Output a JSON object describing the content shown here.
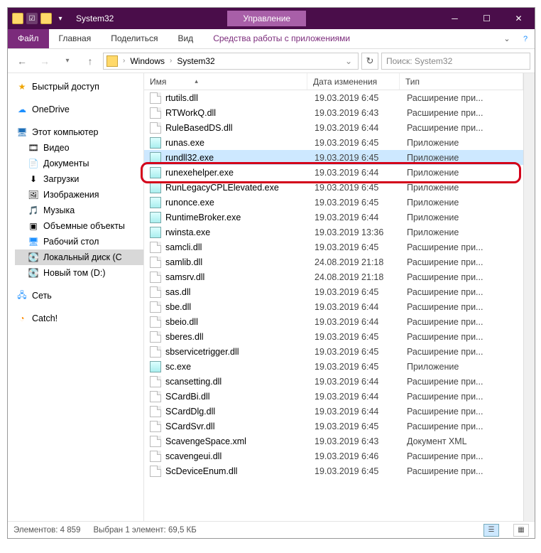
{
  "titlebar": {
    "title": "System32",
    "center_tab": "Управление"
  },
  "ribbon": {
    "file": "Файл",
    "tabs": [
      "Главная",
      "Поделиться",
      "Вид"
    ],
    "context_tab": "Средства работы с приложениями"
  },
  "address": {
    "segments": [
      "Windows",
      "System32"
    ],
    "search_placeholder": "Поиск: System32"
  },
  "nav": {
    "quick": "Быстрый доступ",
    "onedrive": "OneDrive",
    "thispc": "Этот компьютер",
    "pc_items": [
      "Видео",
      "Документы",
      "Загрузки",
      "Изображения",
      "Музыка",
      "Объемные объекты",
      "Рабочий стол"
    ],
    "drives": [
      "Локальный диск (C",
      "Новый том (D:)"
    ],
    "network": "Сеть",
    "catch": "Catch!"
  },
  "columns": {
    "name": "Имя",
    "date": "Дата изменения",
    "type": "Тип"
  },
  "files": [
    {
      "name": "rtutils.dll",
      "date": "19.03.2019 6:45",
      "type": "Расширение при...",
      "exe": false
    },
    {
      "name": "RTWorkQ.dll",
      "date": "19.03.2019 6:43",
      "type": "Расширение при...",
      "exe": false
    },
    {
      "name": "RuleBasedDS.dll",
      "date": "19.03.2019 6:44",
      "type": "Расширение при...",
      "exe": false
    },
    {
      "name": "runas.exe",
      "date": "19.03.2019 6:45",
      "type": "Приложение",
      "exe": true
    },
    {
      "name": "rundll32.exe",
      "date": "19.03.2019 6:45",
      "type": "Приложение",
      "exe": true,
      "selected": true
    },
    {
      "name": "runexehelper.exe",
      "date": "19.03.2019 6:44",
      "type": "Приложение",
      "exe": true
    },
    {
      "name": "RunLegacyCPLElevated.exe",
      "date": "19.03.2019 6:45",
      "type": "Приложение",
      "exe": true
    },
    {
      "name": "runonce.exe",
      "date": "19.03.2019 6:45",
      "type": "Приложение",
      "exe": true
    },
    {
      "name": "RuntimeBroker.exe",
      "date": "19.03.2019 6:44",
      "type": "Приложение",
      "exe": true
    },
    {
      "name": "rwinsta.exe",
      "date": "19.03.2019 13:36",
      "type": "Приложение",
      "exe": true
    },
    {
      "name": "samcli.dll",
      "date": "19.03.2019 6:45",
      "type": "Расширение при...",
      "exe": false
    },
    {
      "name": "samlib.dll",
      "date": "24.08.2019 21:18",
      "type": "Расширение при...",
      "exe": false
    },
    {
      "name": "samsrv.dll",
      "date": "24.08.2019 21:18",
      "type": "Расширение при...",
      "exe": false
    },
    {
      "name": "sas.dll",
      "date": "19.03.2019 6:45",
      "type": "Расширение при...",
      "exe": false
    },
    {
      "name": "sbe.dll",
      "date": "19.03.2019 6:44",
      "type": "Расширение при...",
      "exe": false
    },
    {
      "name": "sbeio.dll",
      "date": "19.03.2019 6:44",
      "type": "Расширение при...",
      "exe": false
    },
    {
      "name": "sberes.dll",
      "date": "19.03.2019 6:45",
      "type": "Расширение при...",
      "exe": false
    },
    {
      "name": "sbservicetrigger.dll",
      "date": "19.03.2019 6:45",
      "type": "Расширение при...",
      "exe": false
    },
    {
      "name": "sc.exe",
      "date": "19.03.2019 6:45",
      "type": "Приложение",
      "exe": true
    },
    {
      "name": "scansetting.dll",
      "date": "19.03.2019 6:44",
      "type": "Расширение при...",
      "exe": false
    },
    {
      "name": "SCardBi.dll",
      "date": "19.03.2019 6:44",
      "type": "Расширение при...",
      "exe": false
    },
    {
      "name": "SCardDlg.dll",
      "date": "19.03.2019 6:44",
      "type": "Расширение при...",
      "exe": false
    },
    {
      "name": "SCardSvr.dll",
      "date": "19.03.2019 6:45",
      "type": "Расширение при...",
      "exe": false
    },
    {
      "name": "ScavengeSpace.xml",
      "date": "19.03.2019 6:43",
      "type": "Документ XML",
      "exe": false
    },
    {
      "name": "scavengeui.dll",
      "date": "19.03.2019 6:46",
      "type": "Расширение при...",
      "exe": false
    },
    {
      "name": "ScDeviceEnum.dll",
      "date": "19.03.2019 6:45",
      "type": "Расширение при...",
      "exe": false
    }
  ],
  "status": {
    "count_label": "Элементов: 4 859",
    "selection_label": "Выбран 1 элемент: 69,5 КБ"
  }
}
